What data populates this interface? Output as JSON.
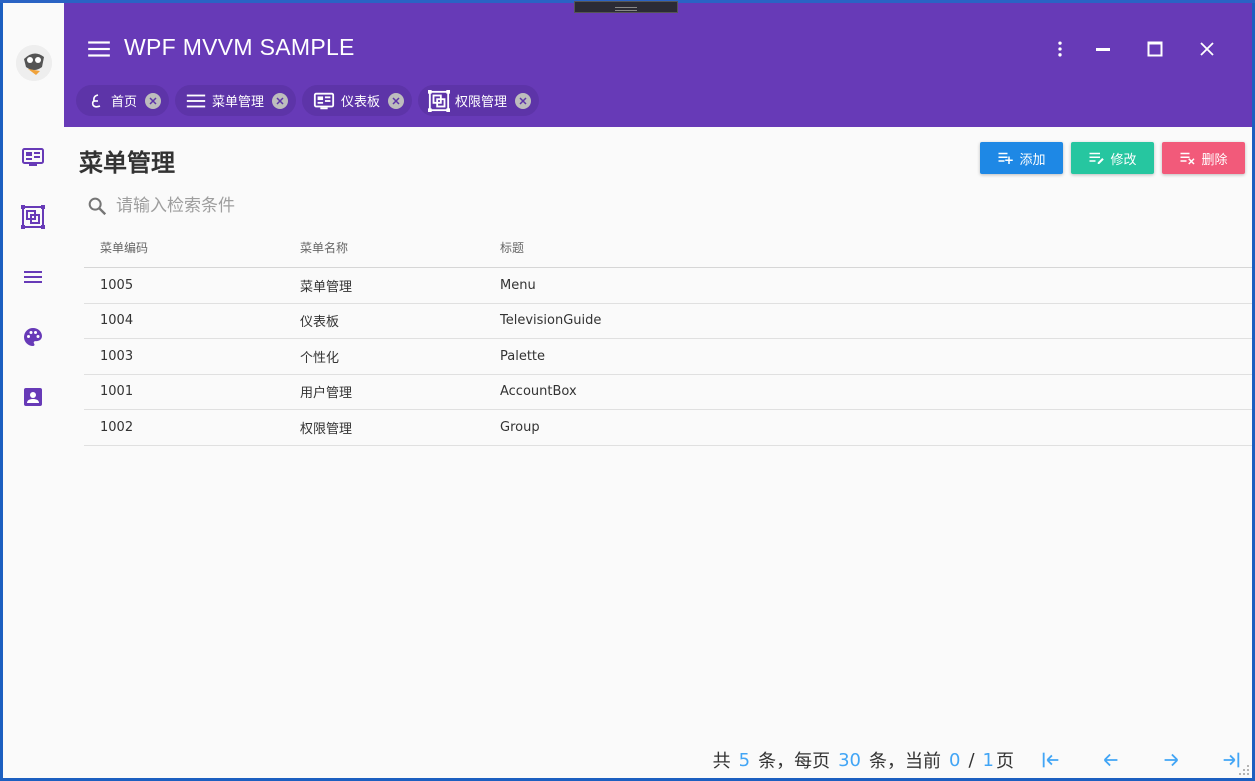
{
  "app": {
    "title": "WPF MVVM SAMPLE"
  },
  "colors": {
    "primary": "#673ab7",
    "add": "#1e88e5",
    "edit": "#26c6a0",
    "delete": "#f25a7a",
    "accent_number": "#42a5f5"
  },
  "rail": {
    "items": [
      {
        "icon": "television-guide-icon"
      },
      {
        "icon": "group-icon"
      },
      {
        "icon": "menu-icon"
      },
      {
        "icon": "palette-icon"
      },
      {
        "icon": "account-box-icon"
      }
    ]
  },
  "tabs": [
    {
      "label": "首页",
      "icon": "home-icon"
    },
    {
      "label": "菜单管理",
      "icon": "menu-icon"
    },
    {
      "label": "仪表板",
      "icon": "television-guide-icon"
    },
    {
      "label": "权限管理",
      "icon": "group-icon"
    }
  ],
  "page": {
    "title": "菜单管理",
    "buttons": {
      "add": "添加",
      "edit": "修改",
      "delete": "删除"
    },
    "search_placeholder": "请输入检索条件"
  },
  "table": {
    "headers": [
      "菜单编码",
      "菜单名称",
      "标题"
    ],
    "rows": [
      [
        "1005",
        "菜单管理",
        "Menu"
      ],
      [
        "1004",
        "仪表板",
        "TelevisionGuide"
      ],
      [
        "1003",
        "个性化",
        "Palette"
      ],
      [
        "1001",
        "用户管理",
        "AccountBox"
      ],
      [
        "1002",
        "权限管理",
        "Group"
      ]
    ]
  },
  "pager": {
    "prefix": "共",
    "total": "5",
    "mid1": "条，每页",
    "page_size": "30",
    "mid2": "条，当前",
    "current": "0",
    "slash": "/",
    "pages": "1",
    "suffix": "页"
  }
}
